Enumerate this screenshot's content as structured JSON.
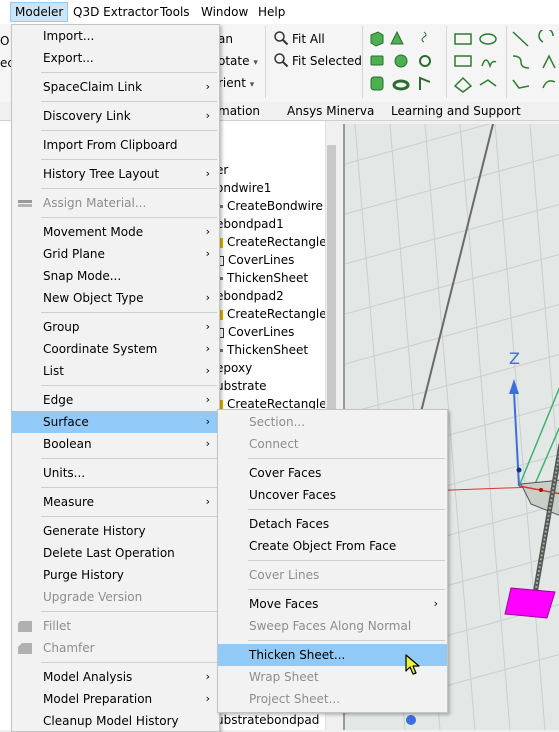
{
  "menubar": {
    "items": [
      "Modeler",
      "Q3D Extractor",
      "Tools",
      "Window",
      "Help"
    ]
  },
  "ribbon": {
    "left_fragments": [
      "O",
      "ec",
      "d"
    ],
    "labels": [
      "an",
      "otate",
      "rient",
      "Fit All",
      "Fit Selected"
    ],
    "dropdown_glyph": "▾",
    "tabs": [
      "mation",
      "Ansys Minerva",
      "Learning and Support"
    ]
  },
  "tree": {
    "items": [
      "er",
      "ondwire1",
      "CreateBondwire",
      "ebondpad1",
      "CreateRectangle",
      "CoverLines",
      "ThickenSheet",
      "ebondpad2",
      "CreateRectangle",
      "CoverLines",
      "ThickenSheet",
      "epoxy",
      "ubstrate",
      "CreateRectangle",
      "ubstratebondpad"
    ]
  },
  "viewport": {
    "axis_label": "Z"
  },
  "modeler_menu": {
    "submenu_arrow": "›",
    "items": [
      {
        "label": "Import...",
        "submenu": false,
        "disabled": false
      },
      {
        "label": "Export...",
        "submenu": false,
        "disabled": false
      },
      {
        "label": "SpaceClaim Link",
        "submenu": true,
        "disabled": false
      },
      {
        "label": "Discovery Link",
        "submenu": true,
        "disabled": false
      },
      {
        "label": "Import From Clipboard",
        "submenu": false,
        "disabled": false
      },
      {
        "label": "History Tree Layout",
        "submenu": true,
        "disabled": false
      },
      {
        "label": "Assign Material...",
        "submenu": false,
        "disabled": true,
        "icon": "material-icon"
      },
      {
        "label": "Movement Mode",
        "submenu": true,
        "disabled": false
      },
      {
        "label": "Grid Plane",
        "submenu": true,
        "disabled": false
      },
      {
        "label": "Snap Mode...",
        "submenu": false,
        "disabled": false
      },
      {
        "label": "New Object Type",
        "submenu": true,
        "disabled": false
      },
      {
        "label": "Group",
        "submenu": true,
        "disabled": false
      },
      {
        "label": "Coordinate System",
        "submenu": true,
        "disabled": false
      },
      {
        "label": "List",
        "submenu": true,
        "disabled": false
      },
      {
        "label": "Edge",
        "submenu": true,
        "disabled": false
      },
      {
        "label": "Surface",
        "submenu": true,
        "disabled": false,
        "highlighted": true
      },
      {
        "label": "Boolean",
        "submenu": true,
        "disabled": false
      },
      {
        "label": "Units...",
        "submenu": false,
        "disabled": false
      },
      {
        "label": "Measure",
        "submenu": true,
        "disabled": false
      },
      {
        "label": "Generate History",
        "submenu": false,
        "disabled": false
      },
      {
        "label": "Delete Last Operation",
        "submenu": false,
        "disabled": false
      },
      {
        "label": "Purge History",
        "submenu": false,
        "disabled": false
      },
      {
        "label": "Upgrade Version",
        "submenu": false,
        "disabled": true
      },
      {
        "label": "Fillet",
        "submenu": false,
        "disabled": true,
        "icon": "fillet-icon"
      },
      {
        "label": "Chamfer",
        "submenu": false,
        "disabled": true,
        "icon": "chamfer-icon"
      },
      {
        "label": "Model Analysis",
        "submenu": true,
        "disabled": false
      },
      {
        "label": "Model Preparation",
        "submenu": true,
        "disabled": false
      },
      {
        "label": "Cleanup Model History",
        "submenu": false,
        "disabled": false
      }
    ]
  },
  "surface_submenu": {
    "items": [
      {
        "label": "Section...",
        "submenu": false,
        "disabled": true
      },
      {
        "label": "Connect",
        "submenu": false,
        "disabled": true
      },
      {
        "label": "Cover Faces",
        "submenu": false,
        "disabled": false
      },
      {
        "label": "Uncover Faces",
        "submenu": false,
        "disabled": false
      },
      {
        "label": "Detach Faces",
        "submenu": false,
        "disabled": false
      },
      {
        "label": "Create Object From Face",
        "submenu": false,
        "disabled": false
      },
      {
        "label": "Cover Lines",
        "submenu": false,
        "disabled": true
      },
      {
        "label": "Move Faces",
        "submenu": true,
        "disabled": false
      },
      {
        "label": "Sweep Faces Along Normal",
        "submenu": false,
        "disabled": true
      },
      {
        "label": "Thicken Sheet...",
        "submenu": false,
        "disabled": false,
        "highlighted": true
      },
      {
        "label": "Wrap Sheet",
        "submenu": false,
        "disabled": true
      },
      {
        "label": "Project Sheet...",
        "submenu": false,
        "disabled": true
      }
    ]
  },
  "colors": {
    "menu_highlight": "#91c9f7",
    "menubar_active": "#cce4f7",
    "disabled_text": "#8d8d8d",
    "object_magenta": "#ff00ff",
    "axis_blue": "#3b6fe0",
    "grid_green": "#3cb371"
  }
}
